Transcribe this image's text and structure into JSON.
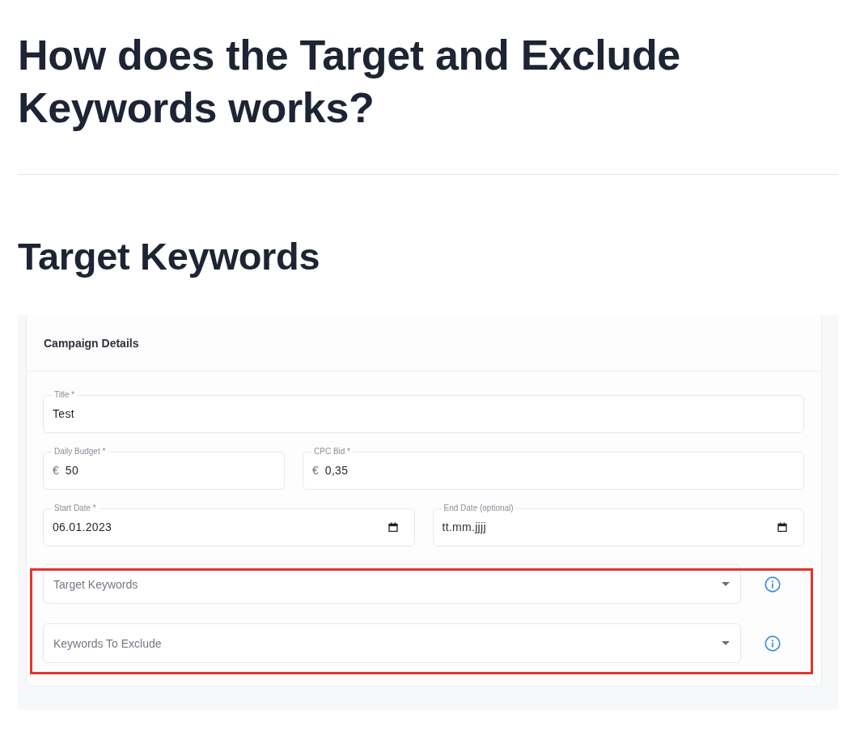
{
  "article": {
    "heading": "How does the Target and Exclude Keywords works?",
    "section_title": "Target Keywords"
  },
  "screenshot": {
    "card_title": "Campaign Details",
    "field_rows": [
      [
        {
          "kind": "text",
          "label": "Title *",
          "value": "Test"
        }
      ],
      [
        {
          "kind": "currency",
          "label": "Daily Budget *",
          "prefix": "€",
          "value": "50"
        },
        {
          "kind": "currency",
          "label": "CPC Bid *",
          "prefix": "€",
          "value": "0,35"
        }
      ],
      [
        {
          "kind": "date",
          "label": "Start Date *",
          "value": "06.01.2023"
        },
        {
          "kind": "date",
          "label": "End Date (optional)",
          "placeholder": "tt.mm.jjjj"
        }
      ]
    ],
    "keyword_selects": [
      {
        "placeholder": "Target Keywords"
      },
      {
        "placeholder": "Keywords To Exclude"
      }
    ],
    "keywords_highlighted": true
  }
}
